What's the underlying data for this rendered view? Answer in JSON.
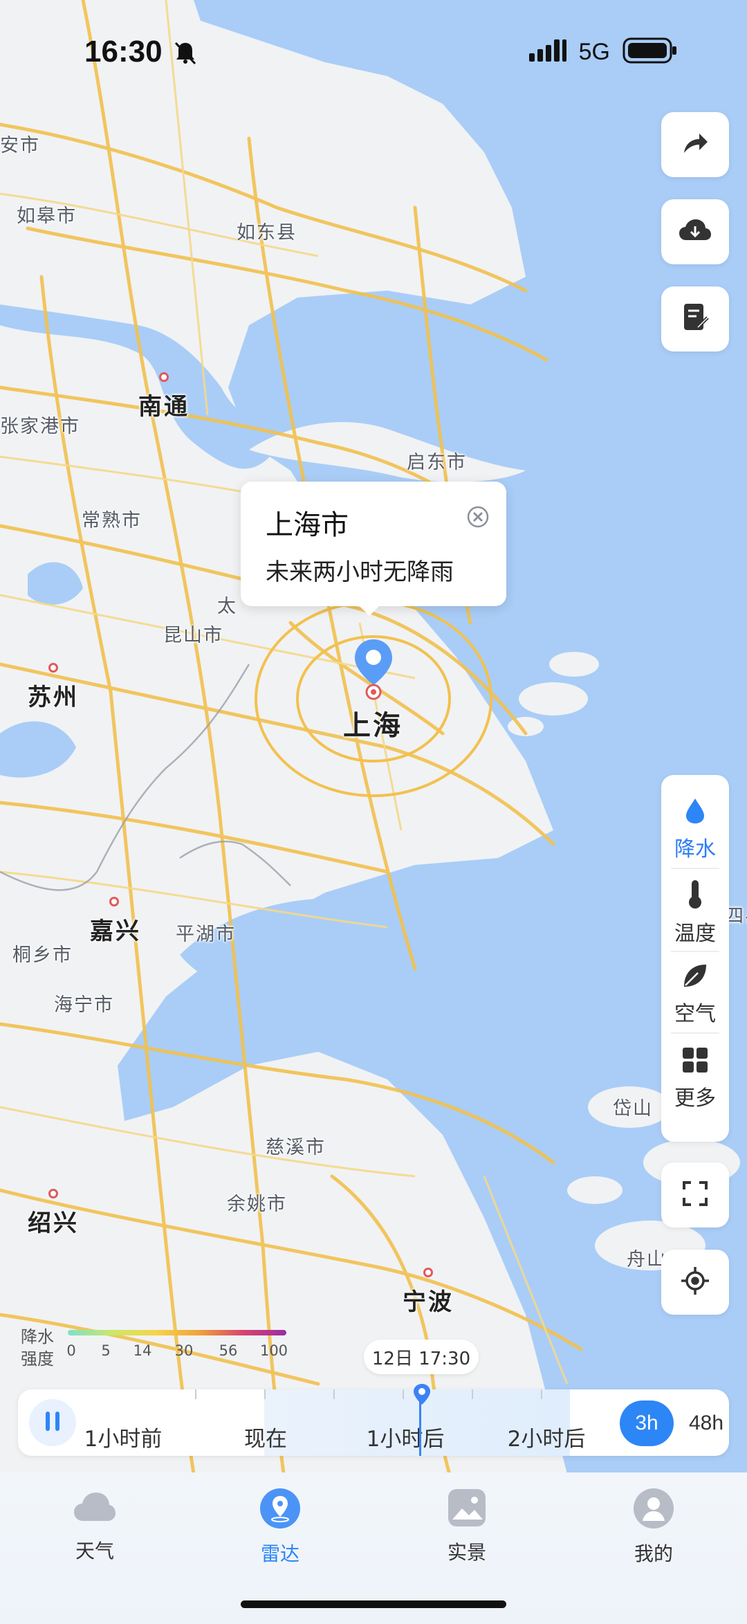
{
  "status_bar": {
    "time": "16:30",
    "network": "5G"
  },
  "map_labels": {
    "anshi": "安市",
    "rugao": "如皋市",
    "rudong": "如东县",
    "nantong": "南通",
    "zhangjiagang": "张家港市",
    "qidong": "启东市",
    "changshu": "常熟市",
    "tai": "太",
    "kunshan": "昆山市",
    "suzhou": "苏州",
    "shanghai": "上海",
    "jiaxing": "嘉兴",
    "pinghu": "平湖市",
    "tongxiang": "桐乡市",
    "haining": "海宁市",
    "cixi": "慈溪市",
    "yuyao": "余姚市",
    "shaoxing": "绍兴",
    "ningbo": "宁波",
    "daishan": "岱山",
    "zhoushan": "舟山",
    "edge_county": "四县"
  },
  "popup": {
    "title": "上海市",
    "subtitle": "未来两小时无降雨"
  },
  "layers": [
    {
      "label": "降水",
      "icon": "raindrop-icon",
      "active": true
    },
    {
      "label": "温度",
      "icon": "thermometer-icon",
      "active": false
    },
    {
      "label": "空气",
      "icon": "leaf-icon",
      "active": false
    },
    {
      "label": "更多",
      "icon": "grid-icon",
      "active": false
    }
  ],
  "legend": {
    "title_line1": "降水",
    "title_line2": "强度",
    "ticks": [
      "0",
      "5",
      "14",
      "30",
      "56",
      "100"
    ]
  },
  "timeline": {
    "current_time": "12日 17:30",
    "labels": [
      "1小时前",
      "现在",
      "1小时后",
      "2小时后"
    ],
    "range_options": [
      "3h",
      "48h"
    ],
    "selected_range": "3h"
  },
  "nav": [
    {
      "label": "天气",
      "icon": "cloud-icon",
      "active": false
    },
    {
      "label": "雷达",
      "icon": "radar-pin-icon",
      "active": true
    },
    {
      "label": "实景",
      "icon": "photo-icon",
      "active": false
    },
    {
      "label": "我的",
      "icon": "user-icon",
      "active": false
    }
  ],
  "colors": {
    "accent": "#2d86f6",
    "sea": "#a9cdf7",
    "land": "#f1f2f4",
    "road": "#f2c14e"
  }
}
